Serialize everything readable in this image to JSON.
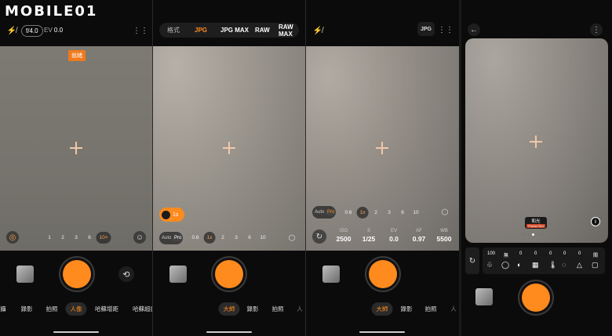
{
  "watermark": {
    "text": "MOBILE01"
  },
  "panel1": {
    "flash_badge": "f/4.0",
    "ev_label": "EV",
    "ev_value": "0.0",
    "ready_badge": "就緒",
    "zoom": [
      "1",
      "2",
      "3",
      "6",
      "10×"
    ],
    "modes": [
      "錄影",
      "拍照",
      "人像",
      "哈蘇增距",
      "哈蘇超廣"
    ],
    "active_mode": "人像",
    "first_mode_fragment": "攝"
  },
  "panel2": {
    "format_tabs": [
      "格式",
      "JPG",
      "JPG MAX",
      "RAW",
      "RAW MAX"
    ],
    "active_format": "JPG",
    "timer_badge": "1s",
    "auto_pro": [
      "Auto",
      "Pro"
    ],
    "zoom": [
      "0.6",
      "1x",
      "2",
      "3",
      "6",
      "10"
    ],
    "modes": [
      "大師",
      "錄影",
      "拍照",
      "人"
    ],
    "active_mode": "大師"
  },
  "panel3": {
    "format_badge": "JPG",
    "auto_pro": [
      "Auto",
      "Pro"
    ],
    "zoom": [
      "0.6",
      "1x",
      "2",
      "3",
      "6",
      "10"
    ],
    "settings": [
      {
        "label": "ISO",
        "value": "2500"
      },
      {
        "label": "S",
        "value": "1/25"
      },
      {
        "label": "EV",
        "value": "0.0"
      },
      {
        "label": "AF",
        "value": "0.97"
      },
      {
        "label": "WB",
        "value": "5500"
      }
    ],
    "modes": [
      "大師",
      "錄影",
      "拍照",
      "人"
    ],
    "active_mode": "大師"
  },
  "panel4": {
    "filter_name": "和光",
    "filter_sub": "Portra Film",
    "dots": 6,
    "adjust_values": [
      "100",
      "無",
      "0",
      "0",
      "0",
      "0",
      "0",
      "關"
    ]
  },
  "colors": {
    "accent": "#ff8a1d"
  }
}
